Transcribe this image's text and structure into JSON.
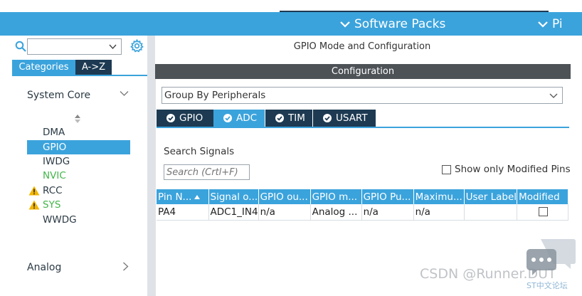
{
  "topbar": {
    "software_packs_label": "Software Packs",
    "pinout_label": "Pi"
  },
  "left": {
    "search": {
      "value": ""
    },
    "tabs": {
      "categories": "Categories",
      "az": "A->Z"
    },
    "system_core": "System Core",
    "items": [
      {
        "label": "DMA",
        "state": "normal",
        "warn": false
      },
      {
        "label": "GPIO",
        "state": "selected",
        "warn": false
      },
      {
        "label": "IWDG",
        "state": "normal",
        "warn": false
      },
      {
        "label": "NVIC",
        "state": "green",
        "warn": false
      },
      {
        "label": "RCC",
        "state": "normal",
        "warn": true
      },
      {
        "label": "SYS",
        "state": "green",
        "warn": true
      },
      {
        "label": "WWDG",
        "state": "normal",
        "warn": false
      }
    ],
    "analog": "Analog"
  },
  "main": {
    "title": "GPIO Mode and Configuration",
    "config_header": "Configuration",
    "group_by": "Group By Peripherals",
    "tabs": [
      "GPIO",
      "ADC",
      "TIM",
      "USART"
    ],
    "active_tab": "ADC",
    "search_signals_label": "Search Signals",
    "search_placeholder": "Search (Crtl+F)",
    "show_modified_label": "Show only Modified Pins",
    "table": {
      "headers": [
        "Pin N...",
        "Signal o...",
        "GPIO ou...",
        "GPIO m...",
        "GPIO Pu...",
        "Maximu...",
        "User Label",
        "Modified"
      ],
      "rows": [
        [
          "PA4",
          "ADC1_IN4",
          "n/a",
          "Analog ...",
          "n/a",
          "n/a",
          "",
          ""
        ]
      ]
    }
  },
  "watermark": {
    "text": "CSDN @Runner.DUT",
    "sub": "ST中文论坛"
  },
  "colors": {
    "accent": "#3ba3dc",
    "dark_navy": "#1d3a52",
    "config_bar": "#4d5257",
    "green": "#42b54a",
    "warning": "#f2b600"
  }
}
